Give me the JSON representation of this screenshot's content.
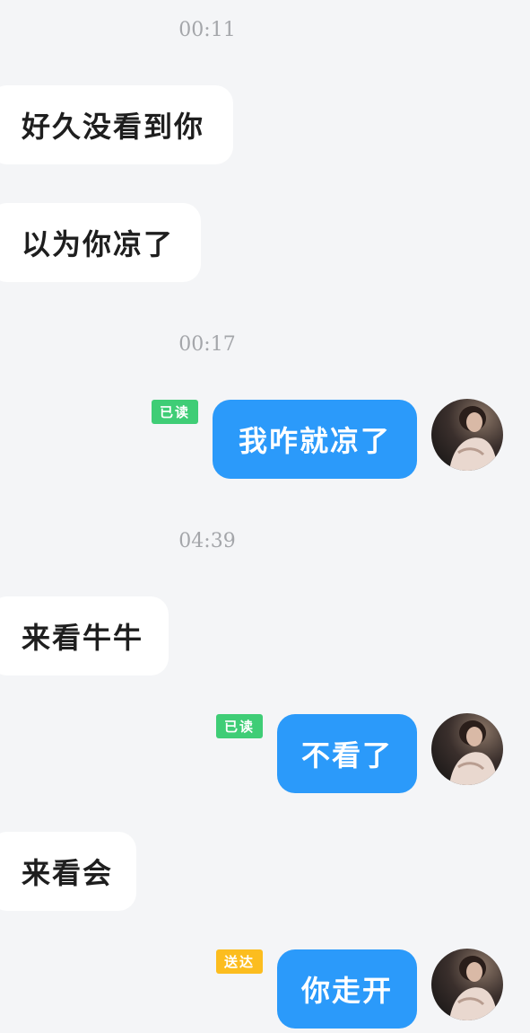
{
  "messages": [
    {
      "type": "timestamp",
      "text": "00:11"
    },
    {
      "type": "incoming",
      "text": "好久没看到你"
    },
    {
      "type": "incoming",
      "text": "以为你凉了"
    },
    {
      "type": "timestamp",
      "text": "00:17"
    },
    {
      "type": "outgoing",
      "text": "我咋就凉了",
      "status": "已读"
    },
    {
      "type": "timestamp",
      "text": "04:39"
    },
    {
      "type": "incoming",
      "text": "来看牛牛"
    },
    {
      "type": "outgoing",
      "text": "不看了",
      "status": "已读"
    },
    {
      "type": "incoming",
      "text": "来看会"
    },
    {
      "type": "outgoing",
      "text": "你走开",
      "status": "送达"
    }
  ],
  "colors": {
    "background": "#f4f5f7",
    "outgoing_bubble": "#2b9afa",
    "incoming_bubble": "#ffffff",
    "read_badge": "#3fcd76",
    "delivered_badge": "#fcbd1f",
    "timestamp_text": "#a4a6aa"
  },
  "icons": {
    "avatar": "user-photo-avatar"
  }
}
